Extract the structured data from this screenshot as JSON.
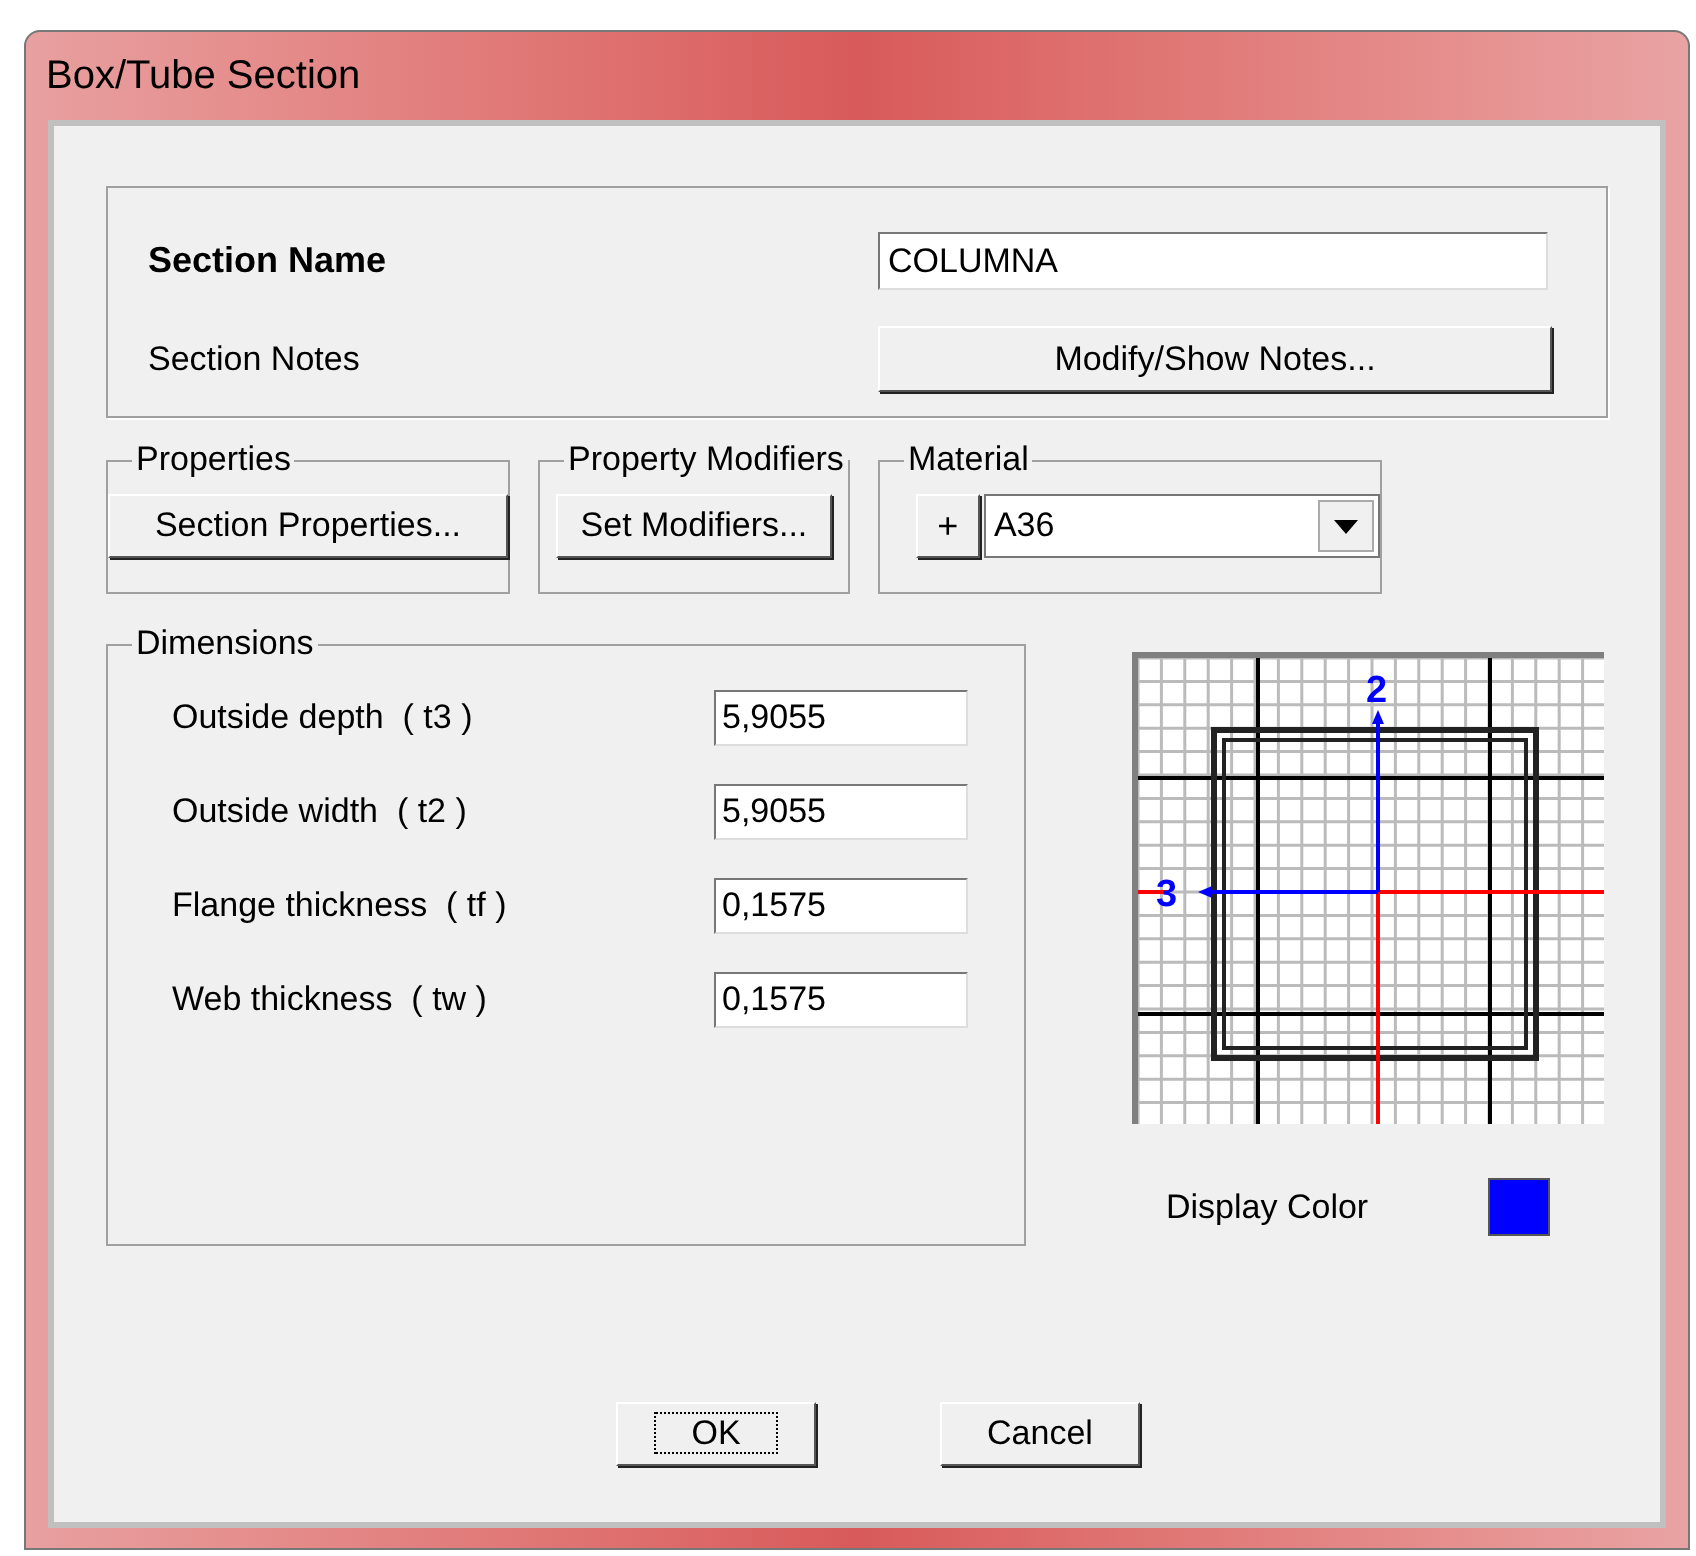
{
  "window": {
    "title": "Box/Tube Section"
  },
  "section_name": {
    "label": "Section Name",
    "value": "COLUMNA"
  },
  "section_notes": {
    "label": "Section Notes",
    "button": "Modify/Show Notes..."
  },
  "properties": {
    "title": "Properties",
    "button": "Section Properties..."
  },
  "property_modifiers": {
    "title": "Property Modifiers",
    "button": "Set Modifiers..."
  },
  "material": {
    "title": "Material",
    "add_button": "+",
    "value": "A36"
  },
  "dimensions": {
    "title": "Dimensions",
    "fields": [
      {
        "label": "Outside depth  ( t3 )",
        "value": "5,9055"
      },
      {
        "label": "Outside width  ( t2 )",
        "value": "5,9055"
      },
      {
        "label": "Flange thickness  ( tf )",
        "value": "0,1575"
      },
      {
        "label": "Web thickness  ( tw )",
        "value": "0,1575"
      }
    ]
  },
  "preview": {
    "axis_labels": [
      "2",
      "3"
    ]
  },
  "display_color": {
    "label": "Display Color",
    "color": "#0000ff"
  },
  "buttons": [
    {
      "label": "OK",
      "focused": true
    },
    {
      "label": "Cancel",
      "focused": false
    }
  ]
}
